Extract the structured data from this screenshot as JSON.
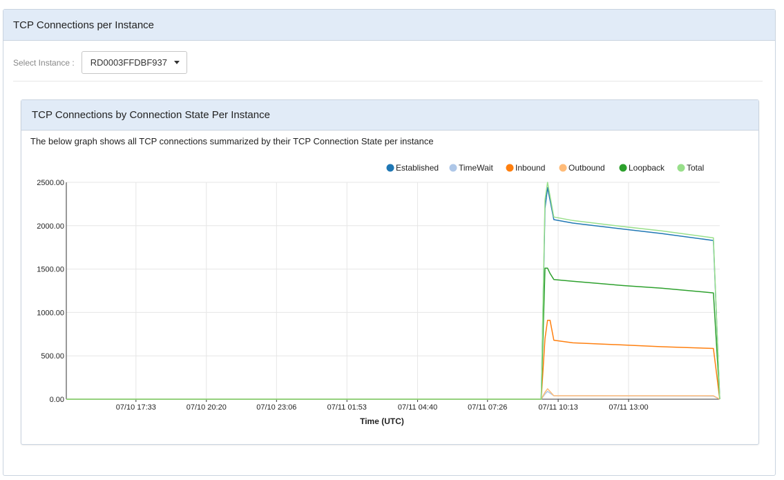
{
  "panel": {
    "title": "TCP Connections per Instance"
  },
  "instance_select": {
    "label": "Select Instance :",
    "value": "RD0003FFDBF937"
  },
  "chart_panel": {
    "title": "TCP Connections by Connection State Per Instance",
    "description": "The below graph shows all TCP connections summarized by their TCP Connection State per instance"
  },
  "chart_data": {
    "type": "line",
    "xlabel": "Time (UTC)",
    "ylabel": "",
    "ylim": [
      0,
      2500
    ],
    "grid": true,
    "legend_position": "top-right",
    "x_ticks": [
      "07/10 17:33",
      "07/10 20:20",
      "07/10 23:06",
      "07/11 01:53",
      "07/11 04:40",
      "07/11 07:26",
      "07/11 10:13",
      "07/11 13:00"
    ],
    "y_ticks": [
      "0.00",
      "500.00",
      "1000.00",
      "1500.00",
      "2000.00",
      "2500.00"
    ],
    "x_hours": [
      0,
      25.8
    ],
    "x_tick_hours": [
      2.75,
      5.53,
      8.3,
      11.08,
      13.87,
      16.63,
      19.42,
      22.2
    ],
    "series": [
      {
        "name": "Established",
        "color": "#1f77b4",
        "x": [
          0,
          18.75,
          18.9,
          19.0,
          19.25,
          20,
          22,
          23.5,
          25.55,
          25.8
        ],
        "y": [
          0,
          0,
          2200,
          2440,
          2070,
          2030,
          1960,
          1910,
          1830,
          0
        ]
      },
      {
        "name": "TimeWait",
        "color": "#aec7e8",
        "x": [
          0,
          18.75,
          18.9,
          19.0,
          19.25,
          25.55,
          25.8
        ],
        "y": [
          0,
          0,
          60,
          90,
          40,
          35,
          0
        ]
      },
      {
        "name": "Inbound",
        "color": "#ff7f0e",
        "x": [
          0,
          18.75,
          18.9,
          19.0,
          19.1,
          19.25,
          20,
          22,
          23.5,
          25.55,
          25.8
        ],
        "y": [
          0,
          0,
          700,
          910,
          910,
          680,
          650,
          625,
          605,
          585,
          0
        ]
      },
      {
        "name": "Outbound",
        "color": "#ffbb78",
        "x": [
          0,
          18.75,
          18.9,
          19.0,
          19.25,
          25.55,
          25.8
        ],
        "y": [
          0,
          0,
          80,
          120,
          40,
          40,
          0
        ]
      },
      {
        "name": "Loopback",
        "color": "#2ca02c",
        "x": [
          0,
          18.75,
          18.9,
          19.0,
          19.1,
          19.25,
          20,
          22,
          23.5,
          25.55,
          25.8
        ],
        "y": [
          0,
          0,
          1510,
          1510,
          1450,
          1380,
          1360,
          1310,
          1280,
          1225,
          0
        ]
      },
      {
        "name": "Total",
        "color": "#98df8a",
        "x": [
          0,
          18.75,
          18.9,
          19.0,
          19.25,
          20,
          22,
          23.5,
          25.55,
          25.8
        ],
        "y": [
          0,
          0,
          2300,
          2500,
          2100,
          2060,
          1990,
          1940,
          1860,
          0
        ]
      }
    ]
  }
}
